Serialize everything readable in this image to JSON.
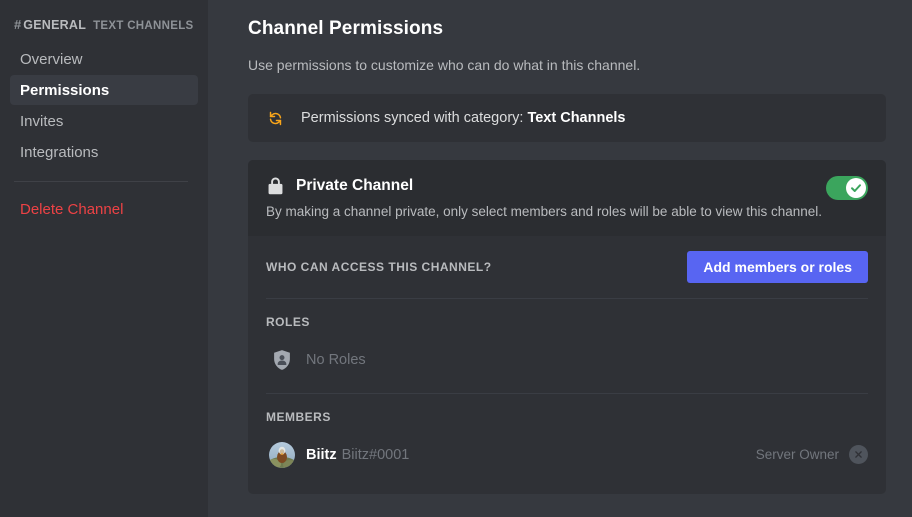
{
  "sidebar": {
    "header": {
      "hash": "#",
      "channel_name": "GENERAL",
      "category": "TEXT CHANNELS"
    },
    "items": [
      {
        "label": "Overview",
        "active": false
      },
      {
        "label": "Permissions",
        "active": true
      },
      {
        "label": "Invites",
        "active": false
      },
      {
        "label": "Integrations",
        "active": false
      }
    ],
    "delete_label": "Delete Channel"
  },
  "main": {
    "title": "Channel Permissions",
    "subtitle": "Use permissions to customize who can do what in this channel.",
    "sync_banner": {
      "icon": "sync-icon",
      "text_prefix": "Permissions synced with category:",
      "category": "Text Channels",
      "icon_color": "#faa61a"
    },
    "private_channel": {
      "icon": "lock-icon",
      "title": "Private Channel",
      "description": "By making a channel private, only select members and roles will be able to view this channel.",
      "toggle_on": true,
      "toggle_color": "#3ba55d"
    },
    "access_section": {
      "label": "WHO CAN ACCESS THIS CHANNEL?",
      "button_label": "Add members or roles",
      "button_color": "#5865f2"
    },
    "roles_section": {
      "label": "ROLES",
      "empty_text": "No Roles",
      "icon": "role-shield-icon"
    },
    "members_section": {
      "label": "MEMBERS",
      "members": [
        {
          "name": "Biitz",
          "tag": "Biitz#0001",
          "role_label": "Server Owner",
          "avatar": "user-avatar"
        }
      ]
    }
  }
}
